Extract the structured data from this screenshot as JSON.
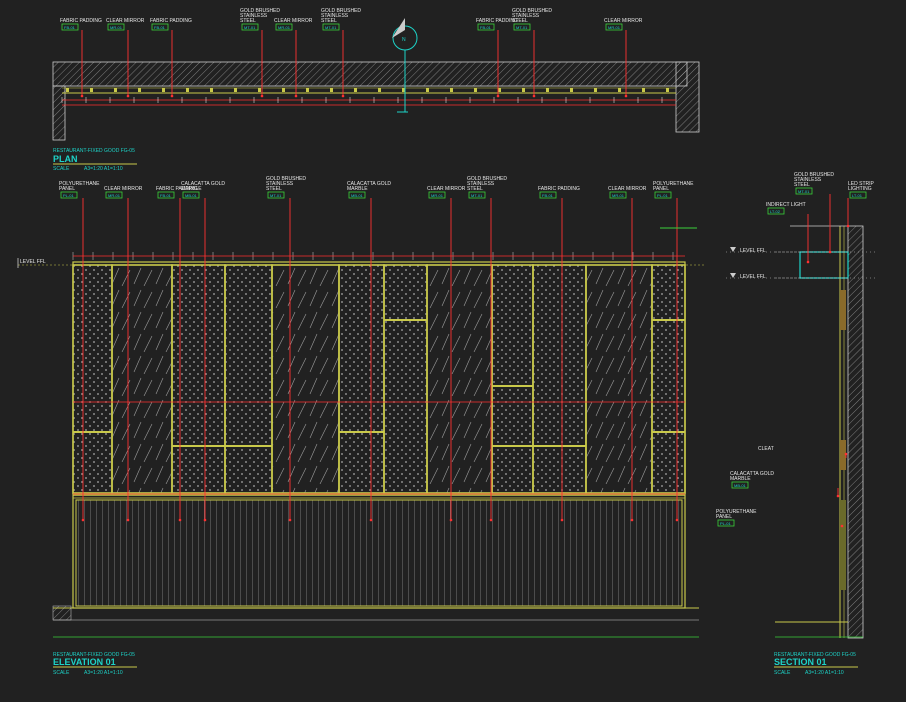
{
  "plan": {
    "subtitle": "RESTAURANT-FIXED GOOD FG-05",
    "title": "PLAN",
    "scale_label": "SCALE",
    "scale_value": "A3=1:20 A1=1:10",
    "north_label": "N",
    "labels": [
      {
        "text": "FABRIC PADDING",
        "code": "FB-01"
      },
      {
        "text": "CLEAR MIRROR",
        "code": "MR-01"
      },
      {
        "text": "FABRIC PADDING",
        "code": "FB-01"
      },
      {
        "text": "GOLD BRUSHED STAINLESS STEEL",
        "code": "MT-01"
      },
      {
        "text": "CLEAR MIRROR",
        "code": "MR-01"
      },
      {
        "text": "GOLD BRUSHED STAINLESS STEEL",
        "code": "MT-01"
      },
      {
        "text": "FABRIC PADDING",
        "code": "FB-01"
      },
      {
        "text": "GOLD BRUSHED STAINLESS STEEL",
        "code": "MT-01"
      },
      {
        "text": "CLEAR MIRROR",
        "code": "MR-01"
      }
    ]
  },
  "elevation": {
    "subtitle": "RESTAURANT-FIXED GOOD FG-05",
    "title": "ELEVATION 01",
    "scale_label": "SCALE",
    "scale_value": "A3=1:20 A1=1:10",
    "level_label": "LEVEL FFL",
    "labels": [
      {
        "text": "POLYURETHANE PANEL",
        "code": "PL-01"
      },
      {
        "text": "CLEAR MIRROR",
        "code": "MR-01"
      },
      {
        "text": "FABRIC PADDING",
        "code": "FB-01"
      },
      {
        "text": "CALACATTA GOLD MARBLE",
        "code": "MB-01"
      },
      {
        "text": "GOLD BRUSHED STAINLESS STEEL",
        "code": "MT-01"
      },
      {
        "text": "CALACATTA GOLD MARBLE",
        "code": "MB-01"
      },
      {
        "text": "CLEAR MIRROR",
        "code": "MR-01"
      },
      {
        "text": "GOLD BRUSHED STAINLESS STEEL",
        "code": "MT-01"
      },
      {
        "text": "FABRIC PADDING",
        "code": "FB-01"
      },
      {
        "text": "CLEAR MIRROR",
        "code": "MR-01"
      },
      {
        "text": "POLYURETHANE PANEL",
        "code": "PL-01"
      }
    ]
  },
  "section": {
    "subtitle": "RESTAURANT-FIXED GOOD FG-05",
    "title": "SECTION 01",
    "scale_label": "SCALE",
    "scale_value": "A3=1:20 A1=1:10",
    "labels": [
      {
        "text": "GOLD BRUSHED STAINLESS STEEL",
        "code": "MT-01"
      },
      {
        "text": "LED STRIP LIGHTING",
        "code": "LT-01"
      },
      {
        "text": "INDIRECT LIGHT",
        "code": "LT-02"
      },
      {
        "text": "CLEAT",
        "code": ""
      },
      {
        "text": "CALACATTA GOLD MARBLE",
        "code": "MB-01"
      },
      {
        "text": "POLYURETHANE PANEL",
        "code": "PL-01"
      }
    ],
    "levels": [
      "LEVEL FFL",
      "LEVEL FFL"
    ]
  }
}
